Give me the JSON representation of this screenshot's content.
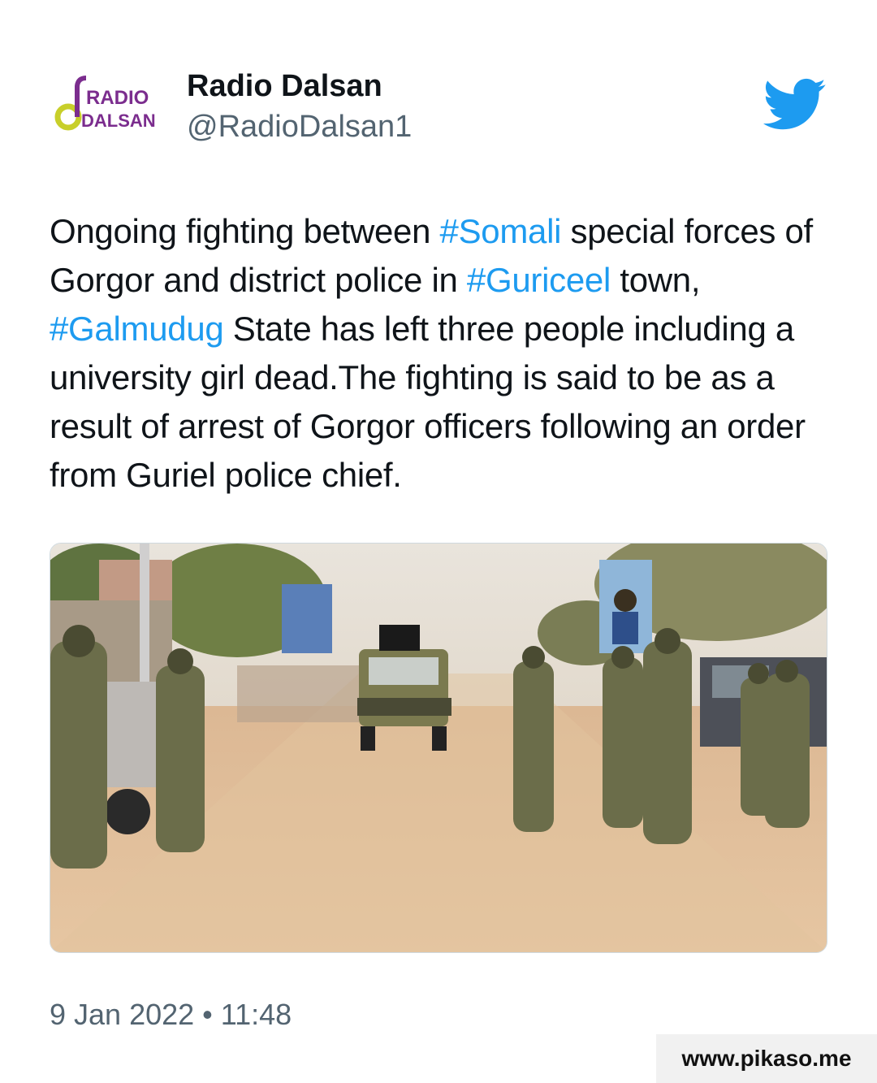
{
  "account": {
    "display_name": "Radio Dalsan",
    "handle": "@RadioDalsan1",
    "avatar_logo_text_top": "RADIO",
    "avatar_logo_text_bottom": "DALSAN"
  },
  "tweet": {
    "segments": [
      {
        "text": "Ongoing fighting between ",
        "type": "text"
      },
      {
        "text": "#Somali",
        "type": "hashtag"
      },
      {
        "text": " special forces of Gorgor and district police in ",
        "type": "text"
      },
      {
        "text": "#Guriceel",
        "type": "hashtag"
      },
      {
        "text": " town, ",
        "type": "text"
      },
      {
        "text": "#Galmudug",
        "type": "hashtag"
      },
      {
        "text": " State has left three people including a university girl dead.The fighting is said to be as a result of arrest of Gorgor officers following an order from Guriel police chief.",
        "type": "text"
      }
    ],
    "timestamp": "9 Jan 2022 • 11:48"
  },
  "media": {
    "icon": "photo-soldiers-street"
  },
  "icons": {
    "platform": "twitter-bird-icon"
  },
  "watermark": "www.pikaso.me",
  "colors": {
    "hashtag": "#1d9bf0",
    "text": "#0f1419",
    "secondary": "#536471",
    "twitter_blue": "#1d9bf0",
    "logo_purple": "#7b2d8e",
    "logo_yellow": "#c8cf2a"
  }
}
